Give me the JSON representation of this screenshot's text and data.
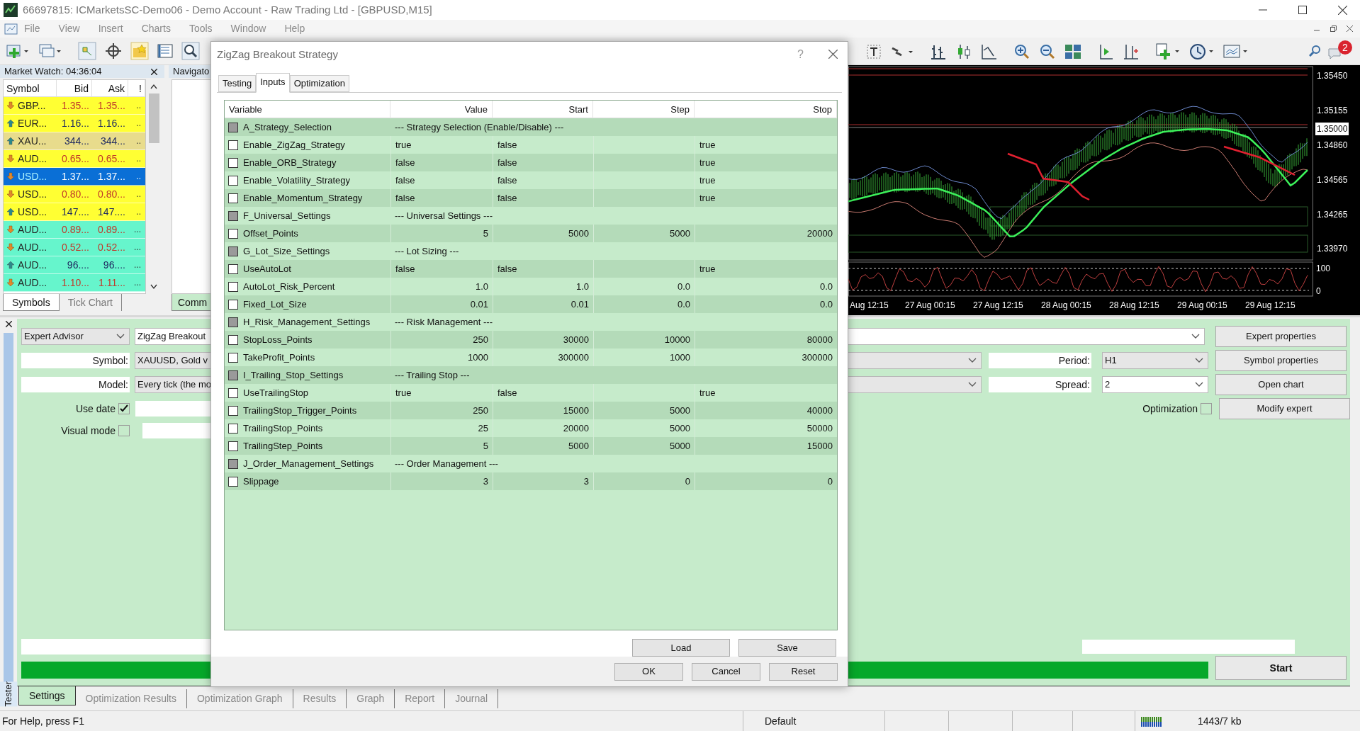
{
  "window": {
    "title": "66697815: ICMarketsSC-Demo06 - Demo Account - Raw Trading Ltd - [GBPUSD,M15]"
  },
  "menu": [
    "File",
    "View",
    "Insert",
    "Charts",
    "Tools",
    "Window",
    "Help"
  ],
  "notification_badge": "2",
  "market_watch": {
    "title": "Market Watch: 04:36:04",
    "columns": [
      "Symbol",
      "Bid",
      "Ask",
      "!"
    ],
    "rows": [
      {
        "symbol": "GBP...",
        "bid": "1.35...",
        "ask": "1.35...",
        "flag": "..",
        "falling": true,
        "color": "#ffff33",
        "selected": false
      },
      {
        "symbol": "EUR...",
        "bid": "1.16...",
        "ask": "1.16...",
        "flag": "..",
        "falling": false,
        "color": "#ffff33",
        "selected": false
      },
      {
        "symbol": "XAU...",
        "bid": "344...",
        "ask": "344...",
        "flag": "..",
        "falling": false,
        "color": "#e8dc8c",
        "selected": false
      },
      {
        "symbol": "AUD...",
        "bid": "0.65...",
        "ask": "0.65...",
        "flag": "..",
        "falling": true,
        "color": "#ffff33",
        "selected": false
      },
      {
        "symbol": "USD...",
        "bid": "1.37...",
        "ask": "1.37...",
        "flag": "..",
        "falling": true,
        "color": "#0a6fd6",
        "selected": true
      },
      {
        "symbol": "USD...",
        "bid": "0.80...",
        "ask": "0.80...",
        "flag": "..",
        "falling": true,
        "color": "#ffff33",
        "selected": false
      },
      {
        "symbol": "USD...",
        "bid": "147....",
        "ask": "147....",
        "flag": "..",
        "falling": false,
        "color": "#ffff33",
        "selected": false
      },
      {
        "symbol": "AUD...",
        "bid": "0.89...",
        "ask": "0.89...",
        "flag": "...",
        "falling": true,
        "color": "#66f5cc",
        "selected": false
      },
      {
        "symbol": "AUD...",
        "bid": "0.52...",
        "ask": "0.52...",
        "flag": "...",
        "falling": true,
        "color": "#66f5cc",
        "selected": false
      },
      {
        "symbol": "AUD...",
        "bid": "96....",
        "ask": "96....",
        "flag": "...",
        "falling": false,
        "color": "#66f5cc",
        "selected": false
      },
      {
        "symbol": "AUD...",
        "bid": "1.10...",
        "ask": "1.11...",
        "flag": "...",
        "falling": true,
        "color": "#66f5cc",
        "selected": false
      }
    ],
    "tabs": [
      {
        "label": "Symbols",
        "selected": true
      },
      {
        "label": "Tick Chart",
        "selected": false
      }
    ]
  },
  "navigator": {
    "title": "Navigato",
    "tab": "Comm"
  },
  "chart": {
    "price_labels": [
      {
        "text": "1.35450",
        "highlighted": false
      },
      {
        "text": "1.35155",
        "highlighted": false
      },
      {
        "text": "1.35000",
        "highlighted": true
      },
      {
        "text": "1.34860",
        "highlighted": false
      },
      {
        "text": "1.34565",
        "highlighted": false
      },
      {
        "text": "1.34265",
        "highlighted": false
      },
      {
        "text": "1.33970",
        "highlighted": false
      }
    ],
    "oscillator_labels": [
      "100",
      "0"
    ],
    "time_labels": [
      "Aug 12:15",
      "27 Aug 00:15",
      "27 Aug 12:15",
      "28 Aug 00:15",
      "28 Aug 12:15",
      "29 Aug 00:15",
      "29 Aug 12:15"
    ]
  },
  "tester": {
    "mode": "Expert Advisor",
    "expert": "ZigZag Breakout",
    "symbol_label": "Symbol:",
    "symbol": "XAUUSD, Gold v",
    "model_label": "Model:",
    "model": "Every tick (the mo",
    "period_label": "Period:",
    "period": "H1",
    "spread_label": "Spread:",
    "spread": "2",
    "use_date": {
      "label": "Use date",
      "checked": true
    },
    "visual_mode": {
      "label": "Visual mode",
      "checked": false
    },
    "optimization": {
      "label": "Optimization",
      "checked": false
    },
    "buttons": [
      "Expert properties",
      "Symbol properties",
      "Open chart",
      "Modify expert"
    ],
    "start": "Start",
    "progress": {
      "level": 1
    },
    "side_label": "Tester",
    "tabs": [
      {
        "label": "Settings",
        "selected": true
      },
      {
        "label": "Optimization Results",
        "selected": false
      },
      {
        "label": "Optimization Graph",
        "selected": false
      },
      {
        "label": "Results",
        "selected": false
      },
      {
        "label": "Graph",
        "selected": false
      },
      {
        "label": "Report",
        "selected": false
      },
      {
        "label": "Journal",
        "selected": false
      }
    ]
  },
  "dialog": {
    "title": "ZigZag Breakout Strategy",
    "help": "?",
    "tabs": [
      {
        "label": "Testing",
        "selected": false
      },
      {
        "label": "Inputs",
        "selected": true
      },
      {
        "label": "Optimization",
        "selected": false
      }
    ],
    "columns": [
      "Variable",
      "Value",
      "Start",
      "Step",
      "Stop"
    ],
    "rows": [
      {
        "kind": "section",
        "name": "A_Strategy_Selection",
        "value": "--- Strategy Selection (Enable/Disable) ---",
        "checked": false
      },
      {
        "kind": "bool",
        "name": "Enable_ZigZag_Strategy",
        "value": "true",
        "start": "false",
        "stop": "true",
        "checked": false
      },
      {
        "kind": "bool",
        "name": "Enable_ORB_Strategy",
        "value": "false",
        "start": "false",
        "stop": "true",
        "checked": false
      },
      {
        "kind": "bool",
        "name": "Enable_Volatility_Strategy",
        "value": "false",
        "start": "false",
        "stop": "true",
        "checked": false
      },
      {
        "kind": "bool",
        "name": "Enable_Momentum_Strategy",
        "value": "false",
        "start": "false",
        "stop": "true",
        "checked": false
      },
      {
        "kind": "section",
        "name": "F_Universal_Settings",
        "value": "--- Universal Settings ---",
        "checked": false
      },
      {
        "kind": "number",
        "name": "Offset_Points",
        "value": "5",
        "start": "5000",
        "step": "5000",
        "stop": "20000",
        "checked": false
      },
      {
        "kind": "section",
        "name": "G_Lot_Size_Settings",
        "value": "--- Lot Sizing ---",
        "checked": false
      },
      {
        "kind": "bool",
        "name": "UseAutoLot",
        "value": "false",
        "start": "false",
        "stop": "true",
        "checked": false
      },
      {
        "kind": "number",
        "name": "AutoLot_Risk_Percent",
        "value": "1.0",
        "start": "1.0",
        "step": "0.0",
        "stop": "0.0",
        "checked": false
      },
      {
        "kind": "number",
        "name": "Fixed_Lot_Size",
        "value": "0.01",
        "start": "0.01",
        "step": "0.0",
        "stop": "0.0",
        "checked": false
      },
      {
        "kind": "section",
        "name": "H_Risk_Management_Settings",
        "value": "--- Risk Management ---",
        "checked": false
      },
      {
        "kind": "number",
        "name": "StopLoss_Points",
        "value": "250",
        "start": "30000",
        "step": "10000",
        "stop": "80000",
        "checked": false
      },
      {
        "kind": "number",
        "name": "TakeProfit_Points",
        "value": "1000",
        "start": "300000",
        "step": "1000",
        "stop": "300000",
        "checked": false
      },
      {
        "kind": "section",
        "name": "I_Trailing_Stop_Settings",
        "value": "--- Trailing Stop ---",
        "checked": false
      },
      {
        "kind": "bool",
        "name": "UseTrailingStop",
        "value": "true",
        "start": "false",
        "stop": "true",
        "checked": false
      },
      {
        "kind": "number",
        "name": "TrailingStop_Trigger_Points",
        "value": "250",
        "start": "15000",
        "step": "5000",
        "stop": "40000",
        "checked": false
      },
      {
        "kind": "number",
        "name": "TrailingStop_Points",
        "value": "25",
        "start": "20000",
        "step": "5000",
        "stop": "50000",
        "checked": false
      },
      {
        "kind": "number",
        "name": "TrailingStep_Points",
        "value": "5",
        "start": "5000",
        "step": "5000",
        "stop": "15000",
        "checked": false
      },
      {
        "kind": "section",
        "name": "J_Order_Management_Settings",
        "value": "--- Order Management ---",
        "checked": false
      },
      {
        "kind": "number",
        "name": "Slippage",
        "value": "3",
        "start": "3",
        "step": "0",
        "stop": "0",
        "checked": false
      }
    ],
    "buttons": [
      "Load",
      "Save"
    ],
    "footer_buttons": [
      "OK",
      "Cancel",
      "Reset"
    ]
  },
  "status_bar": {
    "help": "For Help, press F1",
    "profile": "Default",
    "traffic": "1443/7 kb"
  }
}
